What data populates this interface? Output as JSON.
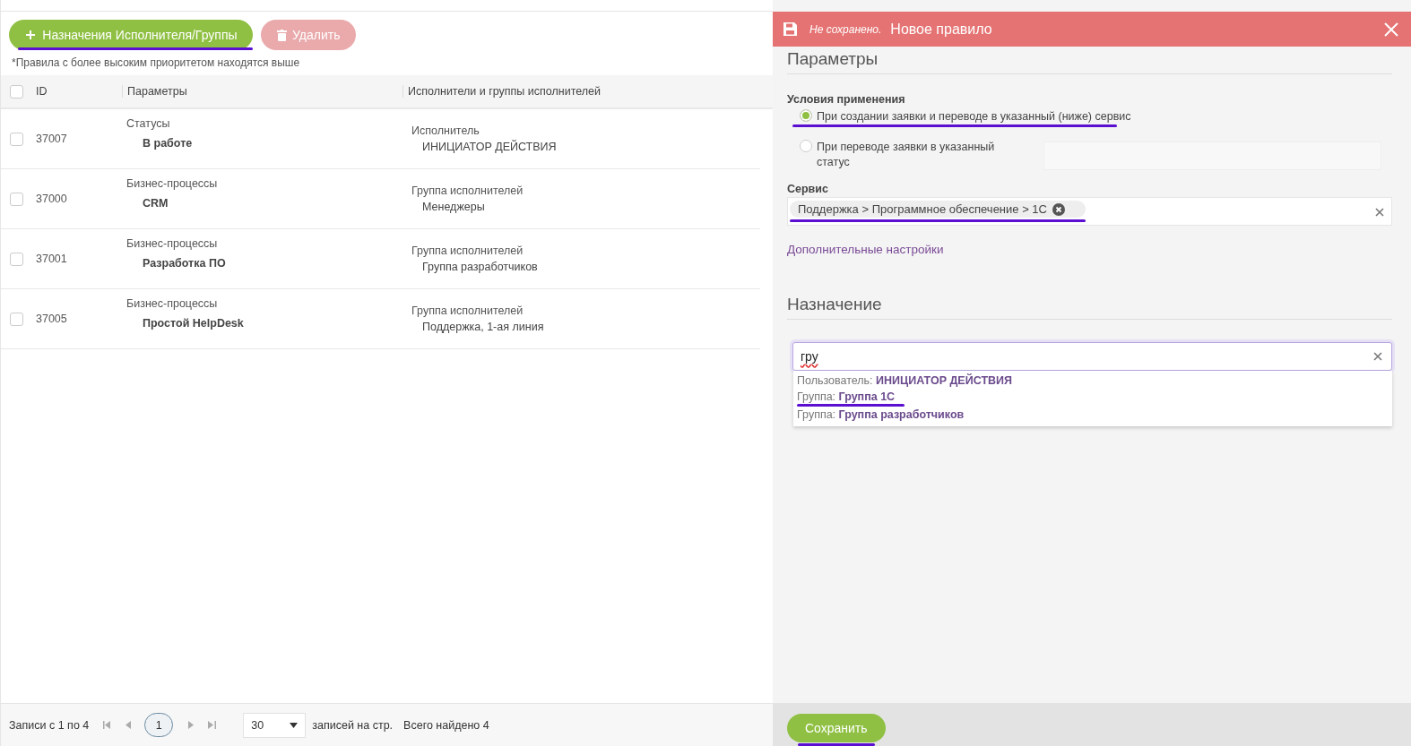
{
  "toolbar": {
    "add_button": "Назначения Исполнителя/Группы",
    "delete_button": "Удалить",
    "note": "*Правила с более высоким приоритетом находятся выше"
  },
  "table": {
    "columns": [
      "ID",
      "Параметры",
      "Исполнители и группы исполнителей"
    ],
    "all_checked": false,
    "rows": [
      {
        "checked": false,
        "id": "37007",
        "param_type": "Статусы",
        "param_value": "В работе",
        "assignee_type": "Исполнитель",
        "assignee": "ИНИЦИАТОР ДЕЙСТВИЯ"
      },
      {
        "checked": false,
        "id": "37000",
        "param_type": "Бизнес-процессы",
        "param_value": "CRM",
        "assignee_type": "Группа исполнителей",
        "assignee": "Менеджеры"
      },
      {
        "checked": false,
        "id": "37001",
        "param_type": "Бизнес-процессы",
        "param_value": "Разработка ПО",
        "assignee_type": "Группа исполнителей",
        "assignee": "Группа разработчиков"
      },
      {
        "checked": false,
        "id": "37005",
        "param_type": "Бизнес-процессы",
        "param_value": "Простой HelpDesk",
        "assignee_type": "Группа исполнителей",
        "assignee": "Поддержка, 1-ая линия"
      }
    ]
  },
  "pager": {
    "range": "Записи с 1 по 4",
    "page": "1",
    "per_page": "30",
    "per_page_label": "записей на стр.",
    "total": "Всего найдено 4"
  },
  "panel": {
    "status": "Не сохранено.",
    "title": "Новое правило",
    "section_params": "Параметры",
    "conditions_label": "Условия применения",
    "conditions": [
      {
        "label": "При создании заявки и переводе в указанный (ниже) сервис",
        "selected": true
      },
      {
        "label": "При переводе заявки в указанный статус",
        "selected": false
      }
    ],
    "service_label": "Сервис",
    "service_tag": "Поддержка > Программное обеспечение > 1С",
    "advanced_link": "Дополнительные настройки",
    "section_assign": "Назначение",
    "assign_query": "гру",
    "suggestions": [
      {
        "prefix": "Пользователь:",
        "value": "ИНИЦИАТОР ДЕЙСТВИЯ"
      },
      {
        "prefix": "Группа:",
        "value": "Группа 1С"
      },
      {
        "prefix": "Группа:",
        "value": "Группа разработчиков"
      }
    ],
    "save_button": "Сохранить"
  }
}
